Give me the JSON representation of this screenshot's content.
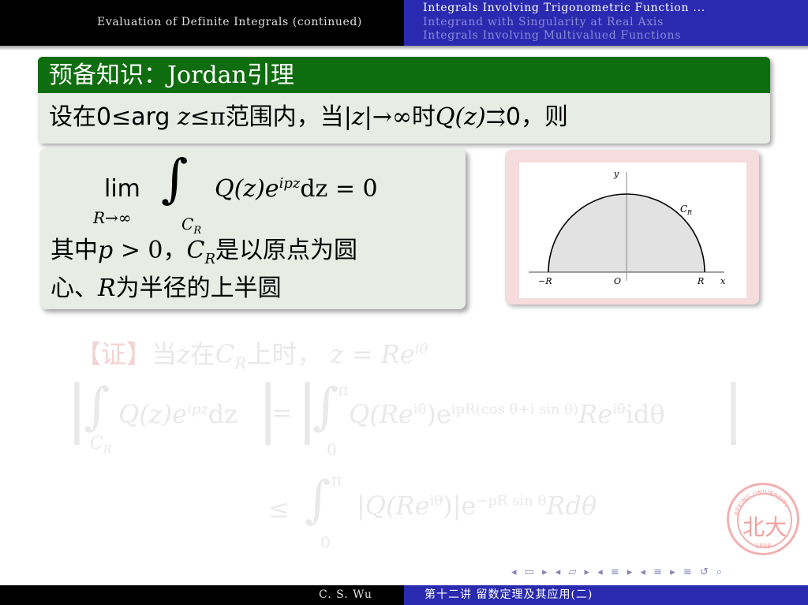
{
  "header": {
    "left_title": "Evaluation of Definite Integrals (continued)",
    "sections": [
      {
        "label": "Integrals Involving Trigonometric Function ...",
        "active": true
      },
      {
        "label": "Integrand with Singularity at Real Axis",
        "active": false
      },
      {
        "label": "Integrals Involving Multivalued Functions",
        "active": false
      }
    ]
  },
  "block1": {
    "title": "预备知识：Jordan引理",
    "condition": {
      "t1": "设在",
      "t2": "0",
      "t3": "≤",
      "t4": "arg",
      "t5": "z",
      "t6": "≤",
      "t7": "π",
      "t8": "范围内，当",
      "t9": "|z|",
      "t10": "→",
      "t11": "∞",
      "t12": "时",
      "t13": "Q(z)",
      "t14": "⇉",
      "t15": "0",
      "t16": "，则"
    }
  },
  "block2": {
    "lim": "lim",
    "lim_sub": "R→∞",
    "int_sign": "∫",
    "int_sub": "C",
    "int_sub_sub": "R",
    "integrand_a": "Q(z)e",
    "integrand_sup": "ipz",
    "integrand_b": "dz = 0",
    "line2_a": "其中",
    "line2_p": "p",
    "line2_b": " > 0，",
    "line2_c": "C",
    "line2_c_sub": "R",
    "line2_d": "是以原点为圆",
    "line3_a": "心、",
    "line3_r": "R",
    "line3_b": "为半径的上半圆"
  },
  "figure": {
    "y_axis": "y",
    "x_axis": "x",
    "curve_label": "C",
    "curve_label_sub": "R",
    "left_tick": "−R",
    "origin": "O",
    "right_tick": "R"
  },
  "proof": {
    "tag": "【证】",
    "line1_a": "当",
    "line1_z": "z",
    "line1_b": "在",
    "line1_c": "C",
    "line1_c_sub": "R",
    "line1_d": "上时，",
    "line1_eq": "z = Re",
    "line1_sup": "iθ",
    "eq1_lhs": "Q(z)e",
    "eq1_lhs_sup": "ipz",
    "eq1_lhs_dz": "dz",
    "eq1_lhs_sub": "C",
    "eq1_lhs_sub_sub": "R",
    "eq1_eq": "=",
    "eq1_int_top": "π",
    "eq1_int_bottom": "0",
    "eq1_rhs_a": "Q(Re",
    "eq1_rhs_a_sup": "iθ",
    "eq1_rhs_b": ")e",
    "eq1_rhs_b_sup": "ipR(cos θ+i sin θ)",
    "eq1_rhs_c": "Re",
    "eq1_rhs_c_sup": "iθ",
    "eq1_rhs_d": "idθ",
    "eq2_le": "≤",
    "eq2_int_top": "π",
    "eq2_int_bottom": "0",
    "eq2_a": "|Q(Re",
    "eq2_a_sup": "iθ",
    "eq2_b": ")|e",
    "eq2_b_sup": "−pR sin θ",
    "eq2_c": "Rdθ"
  },
  "stamp": {
    "text_top": "PEKING UNIVERSITY",
    "year": "1898",
    "emblem": "北大"
  },
  "nav_glyphs": "◂ ▭ ▸ ◂ ▱ ▸ ◂ ≡ ▸ ◂ ≡ ▸ ≡ ↺ ⌕",
  "footer": {
    "author": "C. S. Wu",
    "lecture": "第十二讲 留数定理及其应用(二)"
  },
  "colors": {
    "header_left": "#000000",
    "header_right": "#2a2ab0",
    "block_title": "#0e6d0e",
    "block_body": "#e7ece5",
    "figure_frame": "#f6dcdc"
  }
}
